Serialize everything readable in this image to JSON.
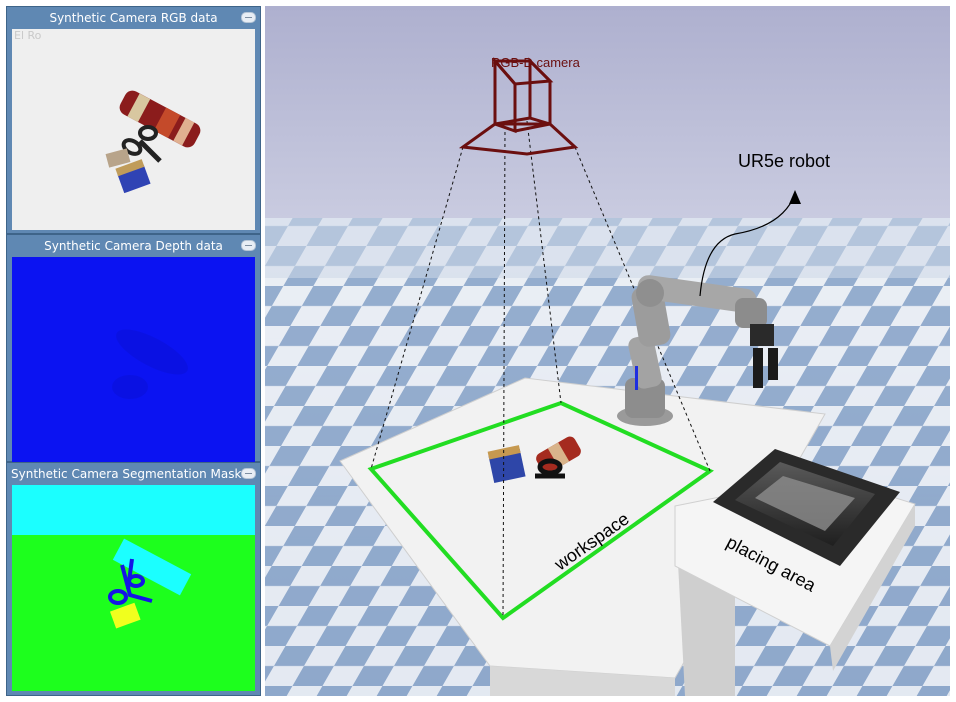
{
  "panels": {
    "rgb": {
      "title": "Synthetic Camera RGB data",
      "ghost": "El Ro"
    },
    "depth": {
      "title": "Synthetic Camera Depth data"
    },
    "segmentation": {
      "title": "Synthetic Camera Segmentation Mask"
    }
  },
  "scene": {
    "camera_label": "RGB-D camera",
    "robot_label": "UR5e robot",
    "workspace_label": "workspace",
    "placing_label": "placing area"
  },
  "colors": {
    "panel_bg": "#5f88b3",
    "depth_bg": "#0b13f2",
    "seg_sky": "#1bffff",
    "seg_ground": "#1dff1d",
    "workspace_outline": "#22dd22",
    "camera_frame": "#6b0f0f"
  }
}
